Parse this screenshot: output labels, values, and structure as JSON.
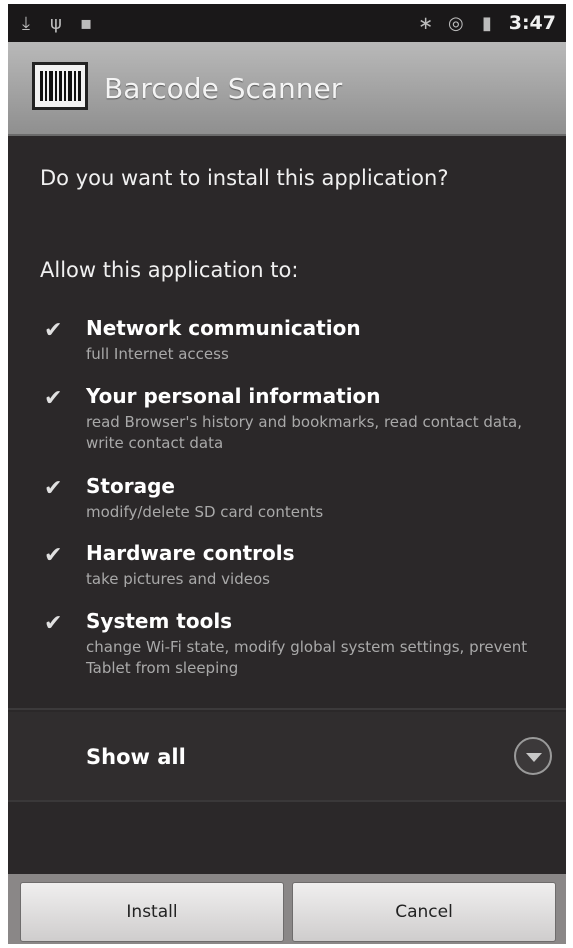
{
  "status_bar": {
    "clock": "3:47",
    "left_icons": [
      "download-icon",
      "usb-icon",
      "sd-card-icon"
    ],
    "right_icons": [
      "bluetooth-icon",
      "sync-icon",
      "battery-icon"
    ]
  },
  "header": {
    "app_icon": "barcode-icon",
    "title": "Barcode Scanner"
  },
  "main": {
    "question": "Do you want to install this application?",
    "allow_heading": "Allow this application to:",
    "permissions": [
      {
        "title": "Network communication",
        "description": "full Internet access"
      },
      {
        "title": "Your personal information",
        "description": "read Browser's history and bookmarks, read contact data, write contact data"
      },
      {
        "title": "Storage",
        "description": "modify/delete SD card contents"
      },
      {
        "title": "Hardware controls",
        "description": "take pictures and videos"
      },
      {
        "title": "System tools",
        "description": "change Wi-Fi state, modify global system settings, prevent Tablet from sleeping"
      }
    ],
    "show_all_label": "Show all"
  },
  "buttons": {
    "install_label": "Install",
    "cancel_label": "Cancel"
  },
  "colors": {
    "background": "#2b2829",
    "title_bar": "#a5a5a5",
    "primary_text": "#ffffff",
    "secondary_text": "#a9a9a9"
  }
}
